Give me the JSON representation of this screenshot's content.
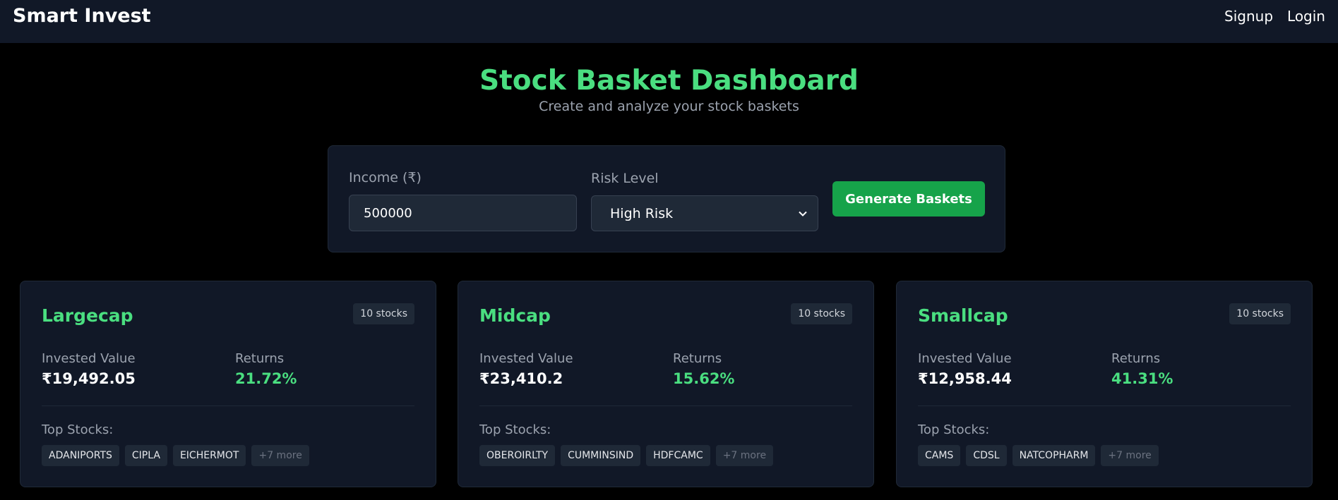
{
  "navbar": {
    "brand": "Smart Invest",
    "links": [
      "Signup",
      "Login"
    ]
  },
  "header": {
    "title": "Stock Basket Dashboard",
    "subtitle": "Create and analyze your stock baskets"
  },
  "form": {
    "income_label": "Income (₹)",
    "income_value": "500000",
    "risk_label": "Risk Level",
    "risk_selected": "High Risk",
    "submit_label": "Generate Baskets"
  },
  "baskets": [
    {
      "name": "Largecap",
      "stock_count": "10 stocks",
      "invested_label": "Invested Value",
      "invested_value": "₹19,492.05",
      "returns_label": "Returns",
      "returns_value": "21.72%",
      "top_label": "Top Stocks:",
      "top_stocks": [
        "ADANIPORTS",
        "CIPLA",
        "EICHERMOT"
      ],
      "more": "+7 more"
    },
    {
      "name": "Midcap",
      "stock_count": "10 stocks",
      "invested_label": "Invested Value",
      "invested_value": "₹23,410.2",
      "returns_label": "Returns",
      "returns_value": "15.62%",
      "top_label": "Top Stocks:",
      "top_stocks": [
        "OBEROIRLTY",
        "CUMMINSIND",
        "HDFCAMC"
      ],
      "more": "+7 more"
    },
    {
      "name": "Smallcap",
      "stock_count": "10 stocks",
      "invested_label": "Invested Value",
      "invested_value": "₹12,958.44",
      "returns_label": "Returns",
      "returns_value": "41.31%",
      "top_label": "Top Stocks:",
      "top_stocks": [
        "CAMS",
        "CDSL",
        "NATCOPHARM"
      ],
      "more": "+7 more"
    }
  ],
  "colors": {
    "accent": "#4ade80",
    "button": "#16a34a",
    "panel": "#111827",
    "background": "#000000"
  }
}
